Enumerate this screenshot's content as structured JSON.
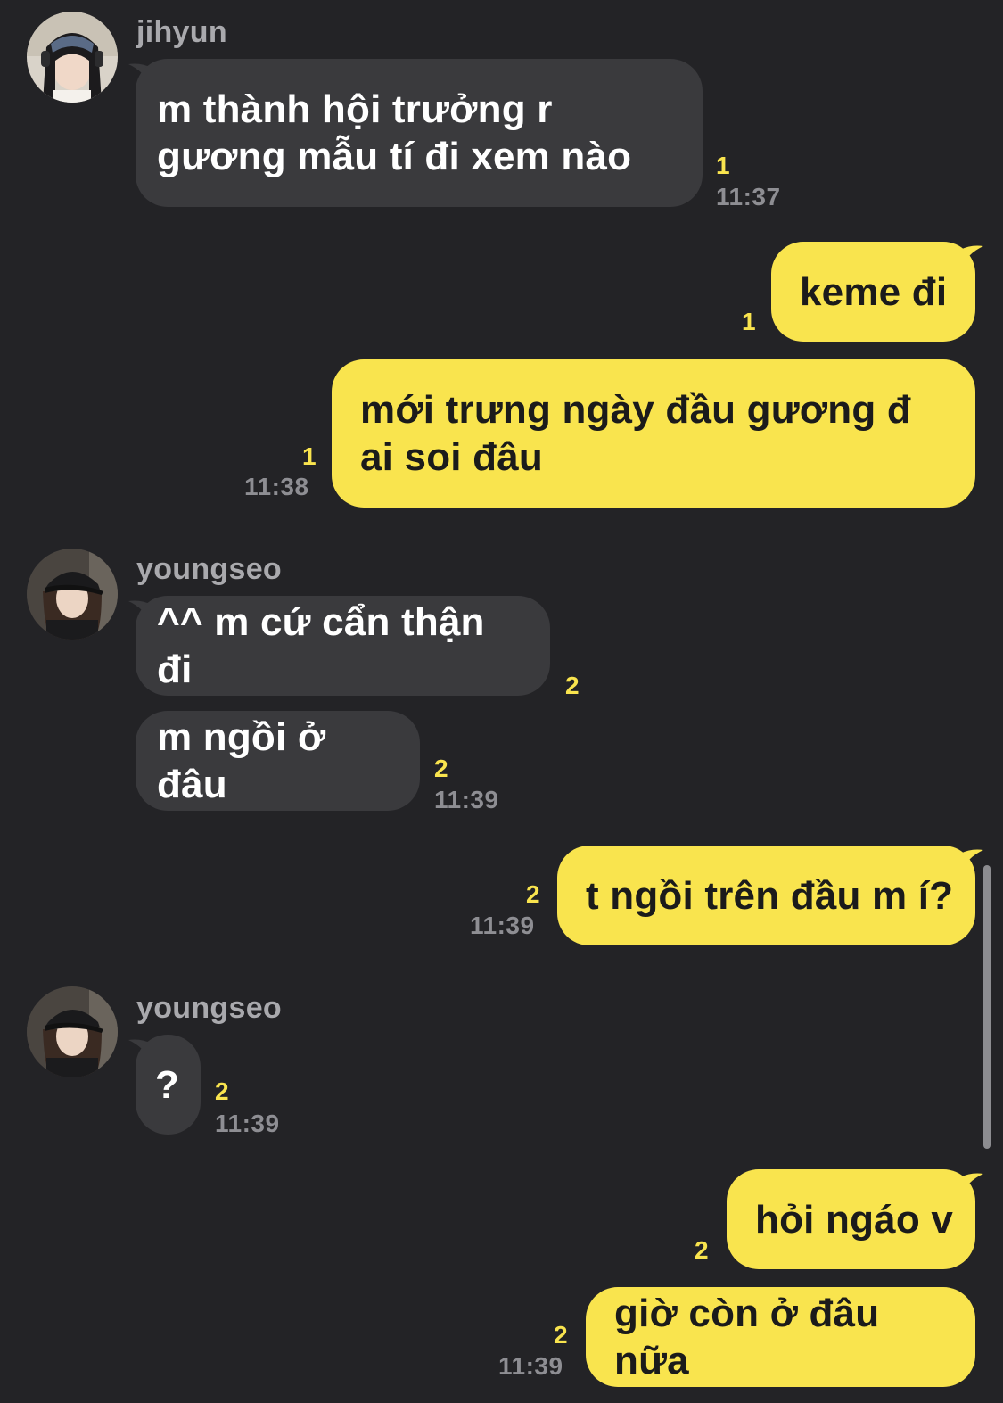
{
  "colors": {
    "background": "#232326",
    "incoming_bubble": "#3a3a3d",
    "outgoing_bubble": "#f9e44e",
    "unread_count": "#f9e44e",
    "timestamp": "#8e8e93",
    "sender_name": "#a9a9ad"
  },
  "messages": [
    {
      "sender": "jihyun",
      "text": "m thành hội trưởng r gương mẫu tí đi xem nào",
      "unread": "1",
      "time": "11:37"
    },
    {
      "sender": "me",
      "text": "keme đi",
      "unread": "1",
      "time": ""
    },
    {
      "sender": "me",
      "text": "mới trưng ngày đầu gương đ ai soi đâu",
      "unread": "1",
      "time": "11:38"
    },
    {
      "sender": "youngseo",
      "text": "^^ m cứ cẩn thận đi",
      "unread": "2",
      "time": ""
    },
    {
      "sender": "youngseo",
      "text": "m ngồi ở đâu",
      "unread": "2",
      "time": "11:39"
    },
    {
      "sender": "me",
      "text": "t ngồi trên đầu m í?",
      "unread": "2",
      "time": "11:39"
    },
    {
      "sender": "youngseo",
      "text": "?",
      "unread": "2",
      "time": "11:39"
    },
    {
      "sender": "me",
      "text": "hỏi ngáo v",
      "unread": "2",
      "time": ""
    },
    {
      "sender": "me",
      "text": "giờ còn ở đâu nữa",
      "unread": "2",
      "time": "11:39"
    }
  ],
  "avatars": [
    {
      "sender": "jihyun",
      "icon": "profile-photo-headphones-bandana"
    },
    {
      "sender": "youngseo",
      "icon": "profile-photo-black-cap"
    },
    {
      "sender": "youngseo",
      "icon": "profile-photo-black-cap"
    }
  ]
}
